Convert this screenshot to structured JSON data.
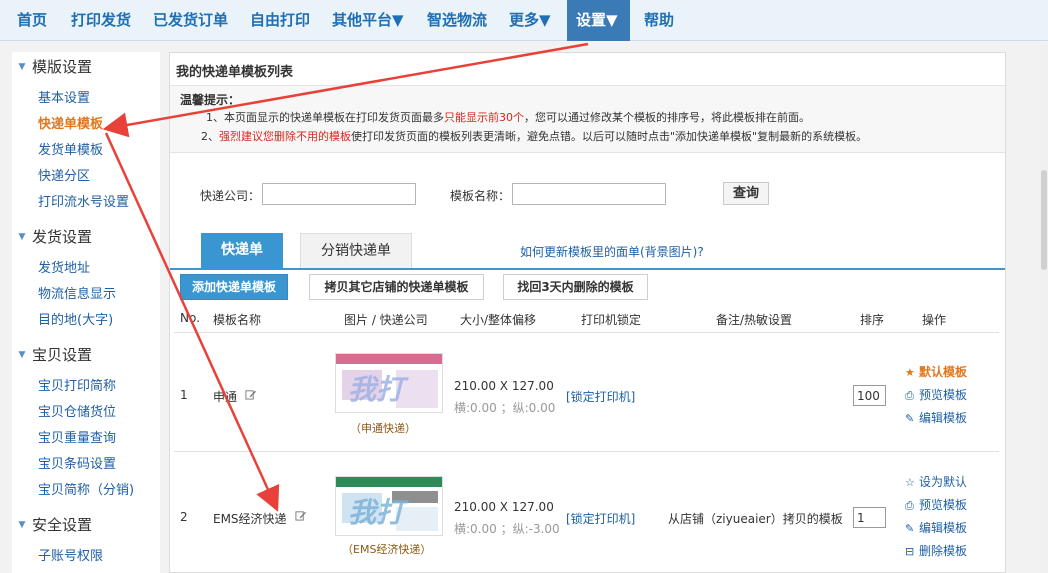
{
  "nav": {
    "items": [
      "首页",
      "打印发货",
      "已发货订单",
      "自由打印",
      "其他平台▼",
      "智选物流",
      "更多▼",
      "设置▼",
      "帮助"
    ],
    "active_index": 7
  },
  "sidebar": {
    "sections": [
      {
        "title": "模版设置",
        "items": [
          "基本设置",
          "快递单模板",
          "发货单模板",
          "快递分区",
          "打印流水号设置"
        ]
      },
      {
        "title": "发货设置",
        "items": [
          "发货地址",
          "物流信息显示",
          "目的地(大字)"
        ]
      },
      {
        "title": "宝贝设置",
        "items": [
          "宝贝打印简称",
          "宝贝仓储货位",
          "宝贝重量查询",
          "宝贝条码设置",
          "宝贝简称（分销)"
        ]
      },
      {
        "title": "安全设置",
        "items": [
          "子账号权限"
        ]
      }
    ],
    "active_item": "快递单模板"
  },
  "main": {
    "title": "我的快递单模板列表",
    "tips": {
      "title": "温馨提示：",
      "line1_a": "1、本页面显示的快递单模板在打印发货页面最多",
      "line1_red": "只能显示前30个",
      "line1_b": "，您可以通过修改某个模板的排序号，将此模板排在前面。",
      "line2_a": "2、",
      "line2_red": "强烈建议您删除不用的模板",
      "line2_b": "使打印发货页面的模板列表更清晰，避免点错。以后可以随时点击\"添加快递单模板\"复制最新的系统模板。"
    },
    "search": {
      "company_label": "快递公司：",
      "company_value": "",
      "template_label": "模板名称：",
      "template_value": "",
      "query_button": "查询"
    },
    "tabs": [
      "快递单",
      "分销快递单"
    ],
    "help_link": "如何更新模板里的面单(背景图片)?",
    "action_buttons": [
      "添加快递单模板",
      "拷贝其它店铺的快递单模板",
      "找回3天内删除的模板"
    ],
    "columns": [
      "No.",
      "模板名称",
      "图片 / 快递公司",
      "大小/整体偏移",
      "打印机锁定",
      "备注/热敏设置",
      "排序",
      "操作"
    ],
    "rows": [
      {
        "no": "1",
        "name": "申通",
        "thumb_text": "我打",
        "carrier": "（申通快递）",
        "size": "210.00 X 127.00",
        "offset": "横:0.00 ；纵:0.00",
        "printer_lock": "[锁定打印机]",
        "note": "",
        "sort": "100",
        "ops": [
          "默认模板",
          "预览模板",
          "编辑模板"
        ]
      },
      {
        "no": "2",
        "name": "EMS经济快递",
        "thumb_text": "我打",
        "carrier": "（EMS经济快递）",
        "size": "210.00 X 127.00",
        "offset": "横:0.00 ；纵:-3.00",
        "printer_lock": "[锁定打印机]",
        "note": "从店铺（ziyueaier）拷贝的模板",
        "sort": "1",
        "ops": [
          "设为默认",
          "预览模板",
          "编辑模板",
          "删除模板"
        ]
      }
    ]
  },
  "colors": {
    "nav_bg": "#eaf2fa",
    "nav_active": "#3a7bb7",
    "accent_blue": "#3a96d1",
    "link": "#1f5fa6",
    "highlight_orange": "#e2781e",
    "warning_red": "#d9261c",
    "annotation_arrow": "#e8413a"
  }
}
